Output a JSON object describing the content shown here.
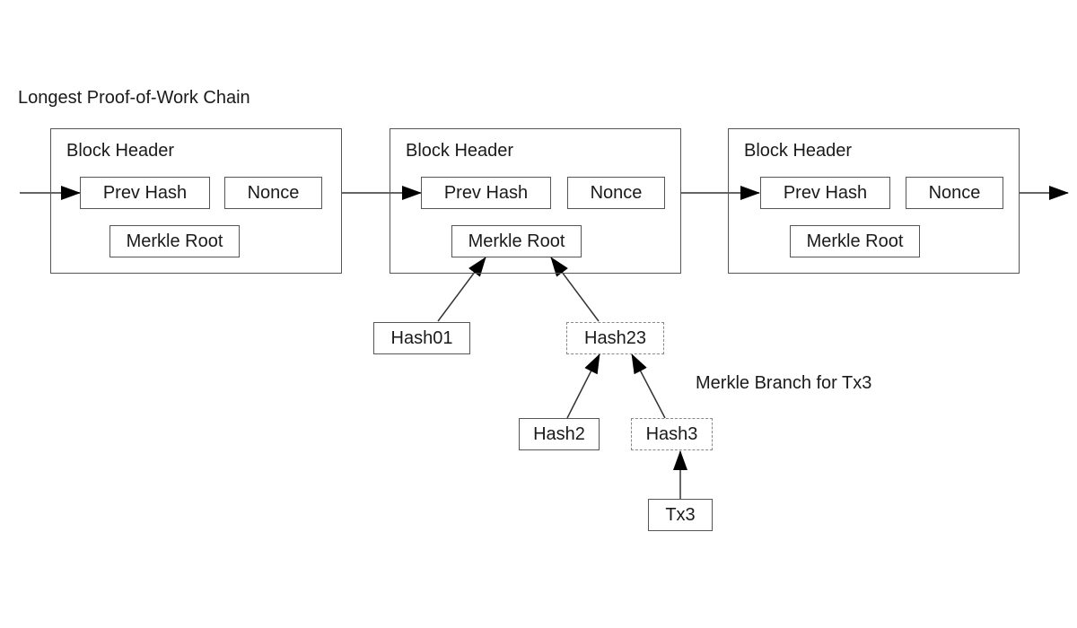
{
  "title": "Longest Proof-of-Work Chain",
  "blocks": [
    {
      "header": "Block Header",
      "prev_hash": "Prev Hash",
      "nonce": "Nonce",
      "merkle_root": "Merkle Root"
    },
    {
      "header": "Block Header",
      "prev_hash": "Prev Hash",
      "nonce": "Nonce",
      "merkle_root": "Merkle Root"
    },
    {
      "header": "Block Header",
      "prev_hash": "Prev Hash",
      "nonce": "Nonce",
      "merkle_root": "Merkle Root"
    }
  ],
  "merkle": {
    "hash01": "Hash01",
    "hash23": "Hash23",
    "hash2": "Hash2",
    "hash3": "Hash3",
    "tx3": "Tx3",
    "branch_label": "Merkle Branch for Tx3"
  }
}
